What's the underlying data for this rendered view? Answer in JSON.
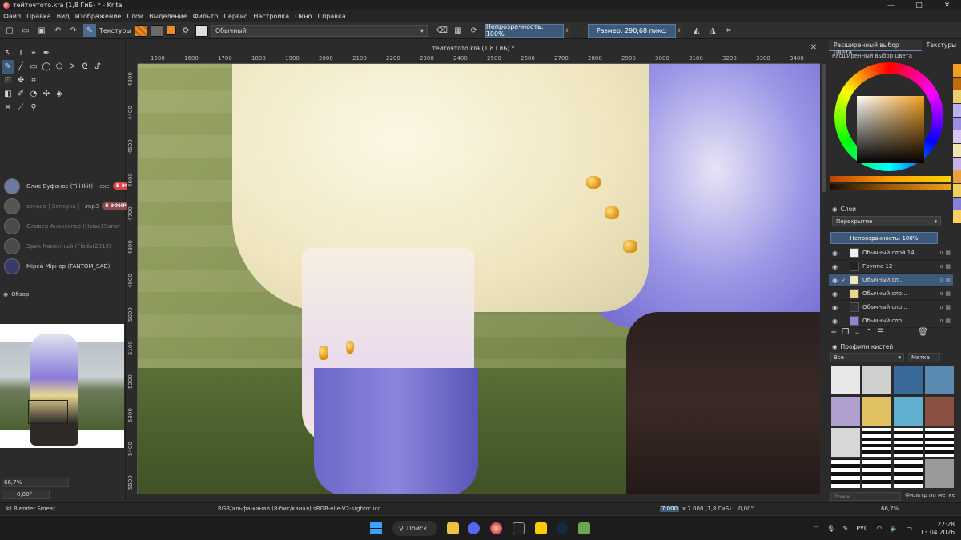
{
  "window": {
    "title": "тейточтото.kra (1,8 ГиБ) * - Krita",
    "controls": [
      "—",
      "□",
      "✕"
    ]
  },
  "menu": [
    "Файл",
    "Правка",
    "Вид",
    "Изображение",
    "Слой",
    "Выделение",
    "Фильтр",
    "Сервис",
    "Настройка",
    "Окно",
    "Справка"
  ],
  "toolbar": {
    "textures_label": "Текстуры",
    "blend_mode": "Обычный",
    "opacity": "Непрозрачность: 100%",
    "size": "Размер: 290,68 пикс.",
    "fg_color": "#e98b2a",
    "bg_color": "#6a6a6a"
  },
  "document_tab": {
    "title": "тейточтото.kra (1,8 ГиБ) *",
    "close": "✕"
  },
  "ruler": {
    "top": [
      "1500",
      "1600",
      "1700",
      "1800",
      "1900",
      "2000",
      "2100",
      "2200",
      "2300",
      "2400",
      "2500",
      "2600",
      "2700",
      "2800",
      "2900",
      "3000",
      "3100",
      "3200",
      "3300",
      "3400"
    ],
    "left": [
      "4300",
      "4400",
      "4500",
      "4600",
      "4700",
      "4800",
      "4900",
      "5000",
      "5100",
      "5200",
      "5300",
      "5400",
      "5500"
    ]
  },
  "discord_overlay": [
    {
      "name": "Олис Буфонос (Till Ikit)",
      "extra": ".exe",
      "live": "В ЭФИРЕ",
      "dim": false
    },
    {
      "name": "soyaaq | Soneyka |",
      "extra": ".mp3",
      "live": "В ЭФИРЕ",
      "dim": true
    },
    {
      "name": "Оливер Анаксагор (Haise1Sano)",
      "extra": "",
      "live": "",
      "dim": true
    },
    {
      "name": "Эрик Каменный (Flodar2319)",
      "extra": "",
      "live": "",
      "dim": true
    },
    {
      "name": "Мірей Мірнор (FANTOM_SAD)",
      "extra": "",
      "live": "",
      "dim": false
    }
  ],
  "overview": {
    "title": "Обзор"
  },
  "zoom": {
    "value": "66,7%",
    "rotation": "0,00°"
  },
  "right_panel": {
    "tabs": [
      "Расширенный выбор цвета",
      "Текстуры"
    ],
    "color_selector_title": "Расширенный выбор цвета",
    "history_colors": [
      "#f0a020",
      "#c06a10",
      "#e8d070",
      "#b8b0f0",
      "#9a90e0",
      "#d8c8f0",
      "#f2e4b0",
      "#c8b0e8",
      "#e8a040",
      "#f0d060",
      "#8880d8",
      "#ffd060"
    ],
    "layers_title": "Слои",
    "layers_blend": "Перекрытие",
    "layers_opacity": "Непрозрачность: 100%",
    "layers": [
      {
        "name": "Обычный слой 14",
        "active": false,
        "checked": false
      },
      {
        "name": "Группа 12",
        "active": false,
        "checked": false
      },
      {
        "name": "Обычный сл...",
        "active": true,
        "checked": true
      },
      {
        "name": "Обычный сло...",
        "active": false,
        "checked": false
      },
      {
        "name": "Обычный сло...",
        "active": false,
        "checked": false
      },
      {
        "name": "Обычный сло...",
        "active": false,
        "checked": false
      }
    ],
    "brush_title": "Профили кистей",
    "brush_filter": "Все",
    "brush_tag": "Метка",
    "brush_search": "Поиск",
    "brush_filter_label": "Фильтр по метке"
  },
  "status": {
    "brush": "k) Blender Smear",
    "color_model": "RGB/альфа-канал (8-бит/канал)  sRGB-elle-V2-srgbtrc.icc",
    "dims_sel": "7 000",
    "dims_rest": "x 7 000 (1,8 ГиБ)",
    "rotation": "0,00°",
    "zoom": "66,7%"
  },
  "taskbar": {
    "search": "Поиск",
    "lang": "РУС",
    "time": "22:28",
    "date": "13.04.2026"
  }
}
